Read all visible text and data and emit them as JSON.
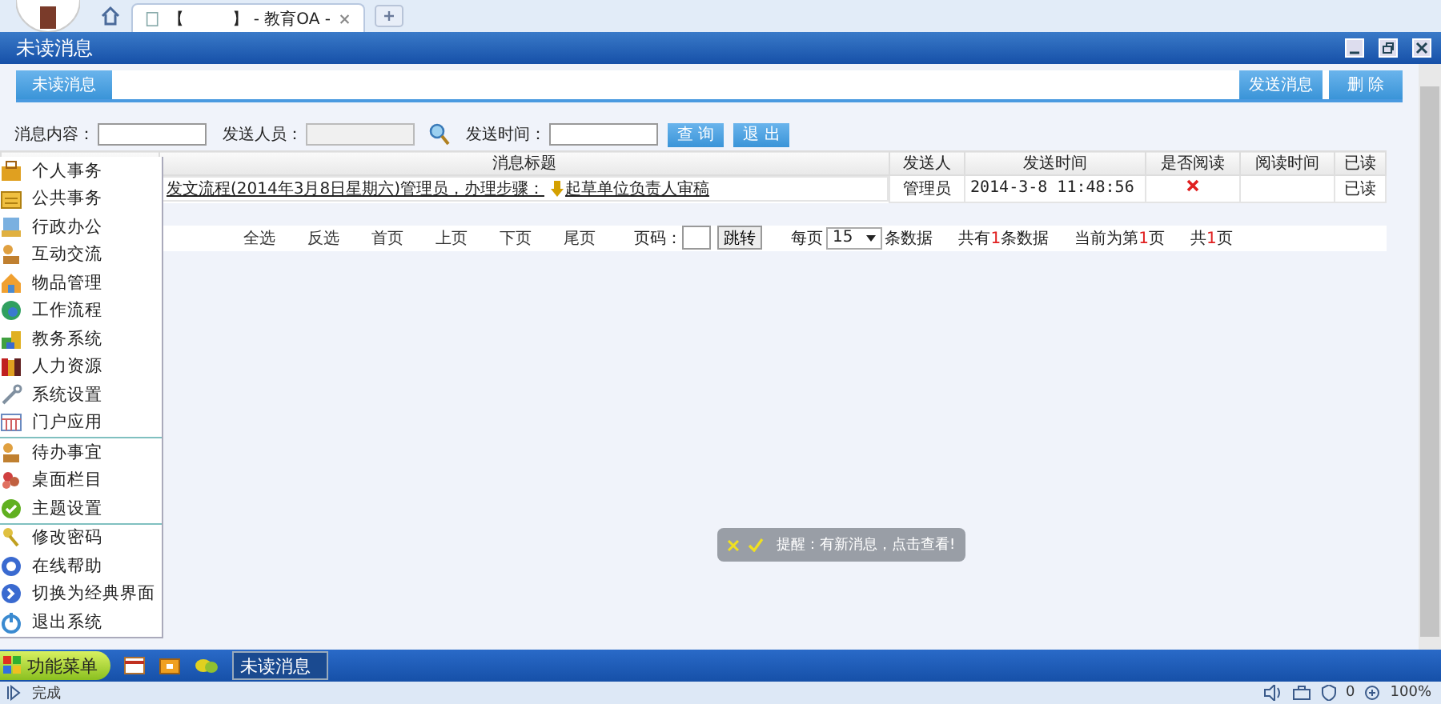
{
  "browser_tab": {
    "title": "【　　　】 - 教育OA -"
  },
  "window": {
    "title": "未读消息"
  },
  "tabs": [
    {
      "label": "未读消息",
      "selected": true
    }
  ],
  "actions": [
    "发送消息",
    "删 除"
  ],
  "search": {
    "fields": [
      {
        "label": "消息内容：",
        "disabled": false
      },
      {
        "label": "发送人员：",
        "disabled": true
      },
      {
        "label": "发送时间：",
        "disabled": false
      }
    ],
    "buttons": [
      "查 询",
      "退 出"
    ]
  },
  "table": {
    "columns": [
      "消息标题",
      "发送人",
      "发送时间",
      "是否阅读",
      "阅读时间",
      "已读"
    ],
    "rows": [
      {
        "title": "发文流程(2014年3月8日星期六)管理员，办理步骤：",
        "step": "起草单位负责人审稿",
        "sender": "管理员",
        "time": "2014-3-8 11:48:56",
        "read": false,
        "read_time": "",
        "status": "已读"
      }
    ]
  },
  "pager": {
    "links": [
      "全选",
      "反选",
      "首页",
      "上页",
      "下页",
      "尾页"
    ],
    "page_label": "页码：",
    "go": "跳转",
    "per_page_label": "每页",
    "per_page": "15",
    "per_page_suffix": "条数据",
    "counts": [
      {
        "prefix": "共有",
        "num": "1",
        "suffix": "条数据"
      },
      {
        "prefix": "当前为第",
        "num": "1",
        "suffix": "页"
      },
      {
        "prefix": "共",
        "num": "1",
        "suffix": "页"
      }
    ]
  },
  "menu": {
    "groups": [
      [
        "个人事务",
        "公共事务",
        "行政办公",
        "互动交流",
        "物品管理",
        "工作流程",
        "教务系统",
        "人力资源",
        "系统设置",
        "门户应用"
      ],
      [
        "待办事宜",
        "桌面栏目",
        "主题设置"
      ],
      [
        "修改密码",
        "在线帮助",
        "切换为经典界面",
        "退出系统"
      ]
    ]
  },
  "toast": {
    "text": "提醒：有新消息，点击查看!"
  },
  "taskbar": {
    "start": "功能菜单",
    "tasks": [
      {
        "label": "未读消息",
        "selected": true
      }
    ]
  },
  "status_bar": {
    "text": "完成",
    "blocked": "0",
    "zoom": "100%"
  }
}
